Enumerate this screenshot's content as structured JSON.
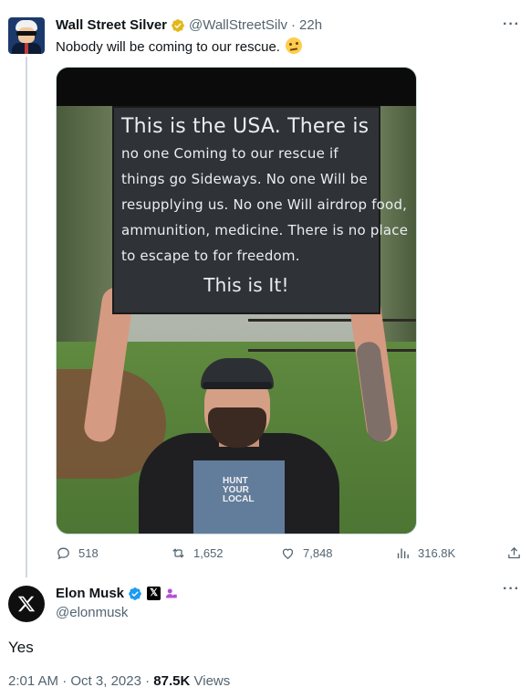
{
  "quoted_tweet": {
    "author_name": "Wall Street Silver",
    "author_handle": "@WallStreetSilv",
    "time_ago": "22h",
    "text": "Nobody will be coming to our rescue.",
    "emoji": "face-with-raised-eyebrow",
    "image": {
      "sign_lines": [
        "This is the USA. There is",
        "no one Coming to our rescue if",
        "things go Sideways. No one Will be",
        "resupplying us. No one Will airdrop food,",
        "ammunition, medicine. There is no place",
        "to escape to for freedom.",
        "This is It!"
      ],
      "shirt_text": [
        "HUNT",
        "YOUR",
        "LOCAL"
      ]
    },
    "stats": {
      "replies": "518",
      "reposts": "1,652",
      "likes": "7,848",
      "views": "316.8K"
    },
    "more_label": "···"
  },
  "main_tweet": {
    "author_name": "Elon Musk",
    "author_handle": "@elonmusk",
    "text": "Yes",
    "time": "2:01 AM",
    "date": "Oct 3, 2023",
    "separator": "·",
    "views_count": "87.5K",
    "views_label": "Views",
    "more_label": "···"
  },
  "colors": {
    "verified_gold": "#e2b719",
    "verified_blue": "#1d9bf0",
    "secondary_text": "#536471",
    "divider": "#cfd9de"
  },
  "icons": {
    "reply": "reply-icon",
    "repost": "repost-icon",
    "like": "heart-icon",
    "views": "bar-chart-icon",
    "share": "share-icon",
    "x_logo": "x-logo-icon",
    "affiliate": "affiliate-person-icon"
  }
}
